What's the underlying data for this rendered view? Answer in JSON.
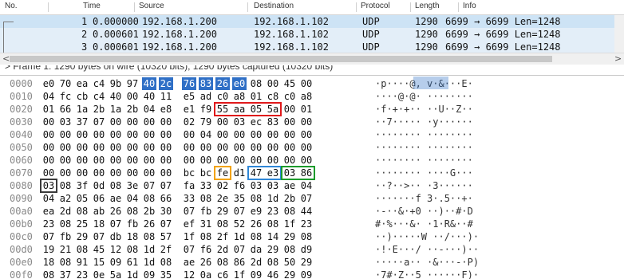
{
  "columns": [
    "No.",
    "Time",
    "Source",
    "Destination",
    "Protocol",
    "Length",
    "Info"
  ],
  "packets": [
    {
      "no": "1",
      "time": "0.000000",
      "src": "192.168.1.200",
      "dst": "192.168.1.102",
      "proto": "UDP",
      "len": "1290",
      "info": "6699 → 6699 Len=1248"
    },
    {
      "no": "2",
      "time": "0.000601",
      "src": "192.168.1.200",
      "dst": "192.168.1.102",
      "proto": "UDP",
      "len": "1290",
      "info": "6699 → 6699 Len=1248"
    },
    {
      "no": "3",
      "time": "0.000601",
      "src": "192.168.1.200",
      "dst": "192.168.1.102",
      "proto": "UDP",
      "len": "1290",
      "info": "6699 → 6699 Len=1248"
    }
  ],
  "detail_text": "> Frame 1: 1290 bytes on wire (10320 bits), 1290 bytes captured (10320 bits)",
  "scroll_left": "<",
  "scroll_right": ">",
  "hex_rows": [
    {
      "off": "0000",
      "bytes": [
        "e0",
        "70",
        "ea",
        "c4",
        "9b",
        "97",
        "40",
        "2c",
        "76",
        "83",
        "26",
        "e0",
        "08",
        "00",
        "45",
        "00"
      ],
      "ascii": "·p····@, v·&···E·"
    },
    {
      "off": "0010",
      "bytes": [
        "04",
        "fc",
        "cb",
        "c4",
        "40",
        "00",
        "40",
        "11",
        "e5",
        "ad",
        "c0",
        "a8",
        "01",
        "c8",
        "c0",
        "a8"
      ],
      "ascii": "····@·@· ········"
    },
    {
      "off": "0020",
      "bytes": [
        "01",
        "66",
        "1a",
        "2b",
        "1a",
        "2b",
        "04",
        "e8",
        "e1",
        "f9",
        "55",
        "aa",
        "05",
        "5a",
        "00",
        "01"
      ],
      "ascii": "·f·+·+·· ··U··Z··"
    },
    {
      "off": "0030",
      "bytes": [
        "00",
        "03",
        "37",
        "07",
        "00",
        "00",
        "00",
        "00",
        "02",
        "79",
        "00",
        "03",
        "ec",
        "83",
        "00",
        "00"
      ],
      "ascii": "··7····· ·y······"
    },
    {
      "off": "0040",
      "bytes": [
        "00",
        "00",
        "00",
        "00",
        "00",
        "00",
        "00",
        "00",
        "00",
        "04",
        "00",
        "00",
        "00",
        "00",
        "00",
        "00"
      ],
      "ascii": "········ ········"
    },
    {
      "off": "0050",
      "bytes": [
        "00",
        "00",
        "00",
        "00",
        "00",
        "00",
        "00",
        "00",
        "00",
        "00",
        "00",
        "00",
        "00",
        "00",
        "00",
        "00"
      ],
      "ascii": "········ ········"
    },
    {
      "off": "0060",
      "bytes": [
        "00",
        "00",
        "00",
        "00",
        "00",
        "00",
        "00",
        "00",
        "00",
        "00",
        "00",
        "00",
        "00",
        "00",
        "00",
        "00"
      ],
      "ascii": "········ ········"
    },
    {
      "off": "0070",
      "bytes": [
        "00",
        "00",
        "00",
        "00",
        "00",
        "00",
        "00",
        "00",
        "bc",
        "bc",
        "fe",
        "d1",
        "47",
        "e3",
        "03",
        "86"
      ],
      "ascii": "········ ····G···"
    },
    {
      "off": "0080",
      "bytes": [
        "03",
        "08",
        "3f",
        "0d",
        "08",
        "3e",
        "07",
        "07",
        "fa",
        "33",
        "02",
        "f6",
        "03",
        "03",
        "ae",
        "04"
      ],
      "ascii": "··?··>·· ·3······"
    },
    {
      "off": "0090",
      "bytes": [
        "04",
        "a2",
        "05",
        "06",
        "ae",
        "04",
        "08",
        "66",
        "33",
        "08",
        "2e",
        "35",
        "08",
        "1d",
        "2b",
        "07"
      ],
      "ascii": "·······f 3·.5··+·"
    },
    {
      "off": "00a0",
      "bytes": [
        "ea",
        "2d",
        "08",
        "ab",
        "26",
        "08",
        "2b",
        "30",
        "07",
        "fb",
        "29",
        "07",
        "e9",
        "23",
        "08",
        "44"
      ],
      "ascii": "·-··&·+0 ··)··#·D"
    },
    {
      "off": "00b0",
      "bytes": [
        "23",
        "08",
        "25",
        "18",
        "07",
        "fb",
        "26",
        "07",
        "ef",
        "31",
        "08",
        "52",
        "26",
        "08",
        "1f",
        "23"
      ],
      "ascii": "#·%···&· ·1·R&··#"
    },
    {
      "off": "00c0",
      "bytes": [
        "07",
        "fb",
        "29",
        "07",
        "db",
        "18",
        "08",
        "57",
        "1f",
        "08",
        "2f",
        "1d",
        "08",
        "14",
        "29",
        "08"
      ],
      "ascii": "··)·····W ··/···)·"
    },
    {
      "off": "00d0",
      "bytes": [
        "19",
        "21",
        "08",
        "45",
        "12",
        "08",
        "1d",
        "2f",
        "07",
        "f6",
        "2d",
        "07",
        "da",
        "29",
        "08",
        "d9"
      ],
      "ascii": "·!·E···/ ··-···)··"
    },
    {
      "off": "00e0",
      "bytes": [
        "18",
        "08",
        "91",
        "15",
        "09",
        "61",
        "1d",
        "08",
        "ae",
        "26",
        "08",
        "86",
        "2d",
        "08",
        "50",
        "29"
      ],
      "ascii": "·····a·· ·&···-·P)"
    },
    {
      "off": "00f0",
      "bytes": [
        "08",
        "37",
        "23",
        "0e",
        "5a",
        "1d",
        "09",
        "35",
        "12",
        "0a",
        "c6",
        "1f",
        "09",
        "46",
        "29",
        "09"
      ],
      "ascii": "·7#·Z··5 ······F)·"
    }
  ],
  "colors": {
    "selection": "#2f6fc6",
    "red": "#e0191b",
    "orange": "#f2a200",
    "blue": "#2f86d6",
    "green": "#1c9b2c",
    "black": "#3a3a3a"
  }
}
